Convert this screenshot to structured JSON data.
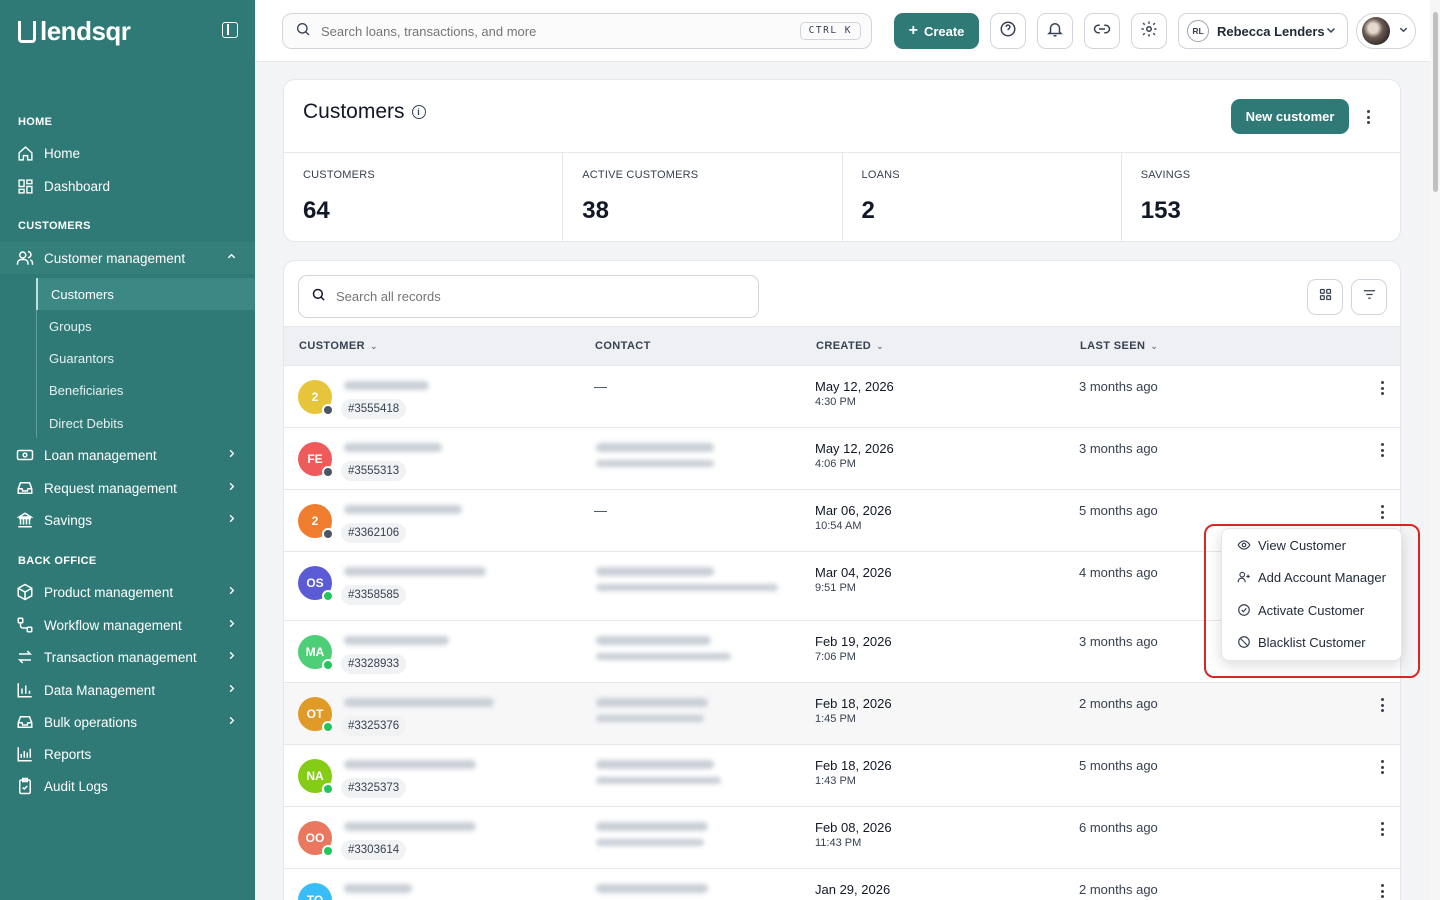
{
  "brand": {
    "name": "lendsqr"
  },
  "sidebar": {
    "sections": {
      "home": "HOME",
      "customers": "CUSTOMERS",
      "back_office": "BACK OFFICE"
    },
    "home_items": [
      {
        "label": "Home",
        "icon": "house-icon"
      },
      {
        "label": "Dashboard",
        "icon": "dashboard-grid-icon"
      }
    ],
    "customer_mgmt": {
      "label": "Customer management",
      "icon": "users-icon",
      "expanded": true
    },
    "customer_sub": [
      "Customers",
      "Groups",
      "Guarantors",
      "Beneficiaries",
      "Direct Debits"
    ],
    "customer_items": [
      {
        "label": "Loan management",
        "icon": "loan-icon"
      },
      {
        "label": "Request management",
        "icon": "inbox-icon"
      },
      {
        "label": "Savings",
        "icon": "bank-icon"
      }
    ],
    "back_office_items": [
      {
        "label": "Product management",
        "icon": "box-icon"
      },
      {
        "label": "Workflow management",
        "icon": "workflow-icon"
      },
      {
        "label": "Transaction management",
        "icon": "transfer-icon"
      },
      {
        "label": "Data Management",
        "icon": "bar-chart-icon"
      },
      {
        "label": "Bulk operations",
        "icon": "inbox-icon"
      },
      {
        "label": "Reports",
        "icon": "report-icon"
      },
      {
        "label": "Audit Logs",
        "icon": "clipboard-icon"
      }
    ]
  },
  "topbar": {
    "search_placeholder": "Search loans, transactions, and more",
    "shortcut": "CTRL K",
    "create_label": "Create",
    "user_initials": "RL",
    "user_name": "Rebecca Lenders"
  },
  "page": {
    "title": "Customers",
    "new_button": "New customer",
    "stats": [
      {
        "label": "CUSTOMERS",
        "value": "64"
      },
      {
        "label": "ACTIVE CUSTOMERS",
        "value": "38"
      },
      {
        "label": "LOANS",
        "value": "2"
      },
      {
        "label": "SAVINGS",
        "value": "153"
      }
    ]
  },
  "table": {
    "search_placeholder": "Search all records",
    "columns": [
      "CUSTOMER",
      "CONTACT",
      "CREATED",
      "LAST SEEN"
    ],
    "rows": [
      {
        "initials": "2",
        "color": "#e6c53a",
        "status": "#4b5563",
        "id": "#3555418",
        "contact": "—",
        "date": "May 12, 2026",
        "time": "4:30 PM",
        "seen": "3 months ago"
      },
      {
        "initials": "FE",
        "color": "#ef5b5b",
        "status": "#4b5563",
        "id": "#3555313",
        "contact": "",
        "date": "May 12, 2026",
        "time": "4:06 PM",
        "seen": "3 months ago"
      },
      {
        "initials": "2",
        "color": "#f07c2e",
        "status": "#4b5563",
        "id": "#3362106",
        "contact": "—",
        "date": "Mar 06, 2026",
        "time": "10:54 AM",
        "seen": "5 months ago"
      },
      {
        "initials": "OS",
        "color": "#5b5bd6",
        "status": "#22c55e",
        "id": "#3358585",
        "contact": "",
        "date": "Mar 04, 2026",
        "time": "9:51 PM",
        "seen": "4 months ago"
      },
      {
        "initials": "MA",
        "color": "#4ccf77",
        "status": "#22c55e",
        "id": "#3328933",
        "contact": "",
        "date": "Feb 19, 2026",
        "time": "7:06 PM",
        "seen": "3 months ago"
      },
      {
        "initials": "OT",
        "color": "#e09a28",
        "status": "#22c55e",
        "id": "#3325376",
        "contact": "",
        "date": "Feb 18, 2026",
        "time": "1:45 PM",
        "seen": "2 months ago"
      },
      {
        "initials": "NA",
        "color": "#84cc16",
        "status": "#22c55e",
        "id": "#3325373",
        "contact": "",
        "date": "Feb 18, 2026",
        "time": "1:43 PM",
        "seen": "5 months ago"
      },
      {
        "initials": "OO",
        "color": "#e9785e",
        "status": "#22c55e",
        "id": "#3303614",
        "contact": "",
        "date": "Feb 08, 2026",
        "time": "11:43 PM",
        "seen": "6 months ago"
      },
      {
        "initials": "TO",
        "color": "#38bdf8",
        "status": "#22c55e",
        "id": "",
        "contact": "",
        "date": "Jan 29, 2026",
        "time": "",
        "seen": "2 months ago"
      }
    ]
  },
  "row_menu": {
    "items": [
      {
        "label": "View Customer",
        "icon": "eye-icon"
      },
      {
        "label": "Add Account Manager",
        "icon": "user-plus-icon"
      },
      {
        "label": "Activate Customer",
        "icon": "check-circle-icon"
      },
      {
        "label": "Blacklist Customer",
        "icon": "ban-icon"
      }
    ]
  },
  "colors": {
    "brand": "#2f7a76",
    "highlight": "#dc2626"
  }
}
